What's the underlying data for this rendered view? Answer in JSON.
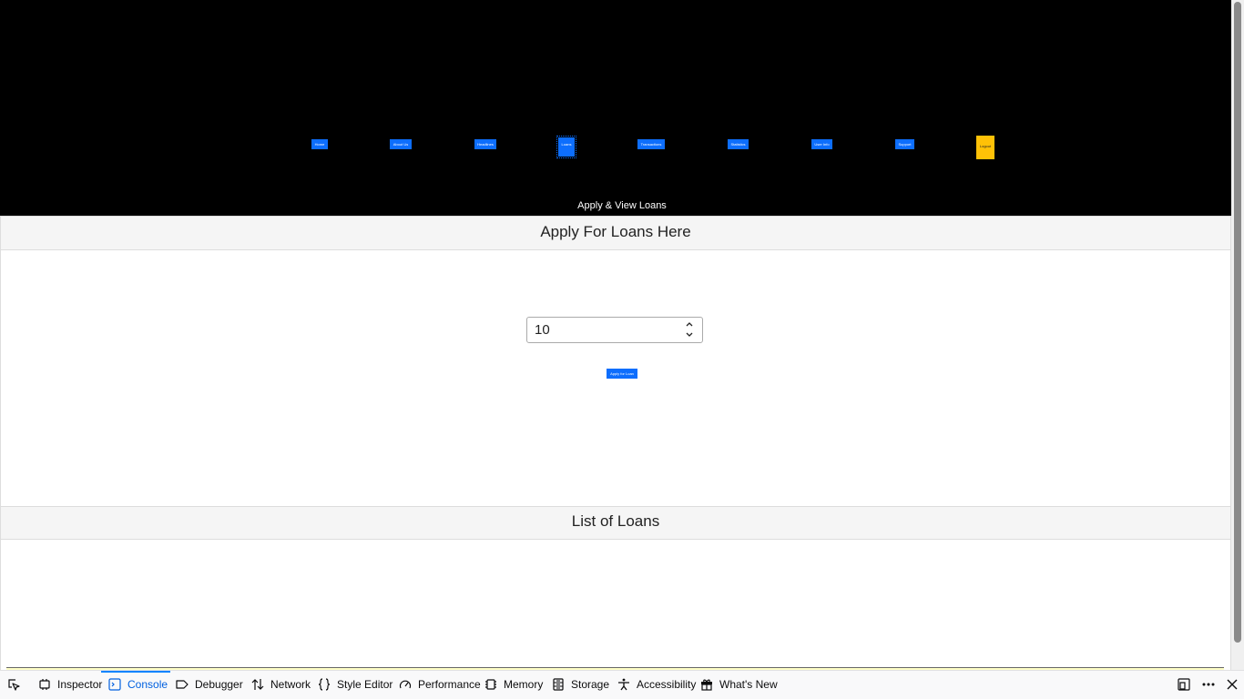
{
  "nav": {
    "items": [
      "Home",
      "About Us",
      "Headlines",
      "Loans",
      "Transactions",
      "Statistics",
      "User Info",
      "Support"
    ],
    "logout": "Logout"
  },
  "header": {
    "subtitle": "Apply & View Loans"
  },
  "apply": {
    "title": "Apply For Loans Here",
    "amount": "10",
    "button": "Apply for Loan"
  },
  "list": {
    "title": "List of Loans"
  },
  "devtools": {
    "tabs": [
      "Inspector",
      "Console",
      "Debugger",
      "Network",
      "Style Editor",
      "Performance",
      "Memory",
      "Storage",
      "Accessibility",
      "What's New"
    ],
    "selected": "Console"
  },
  "colors": {
    "primary": "#0d6efd",
    "warning": "#ffc107",
    "header_bg": "#000000",
    "devtools_accent": "#0a84ff"
  }
}
